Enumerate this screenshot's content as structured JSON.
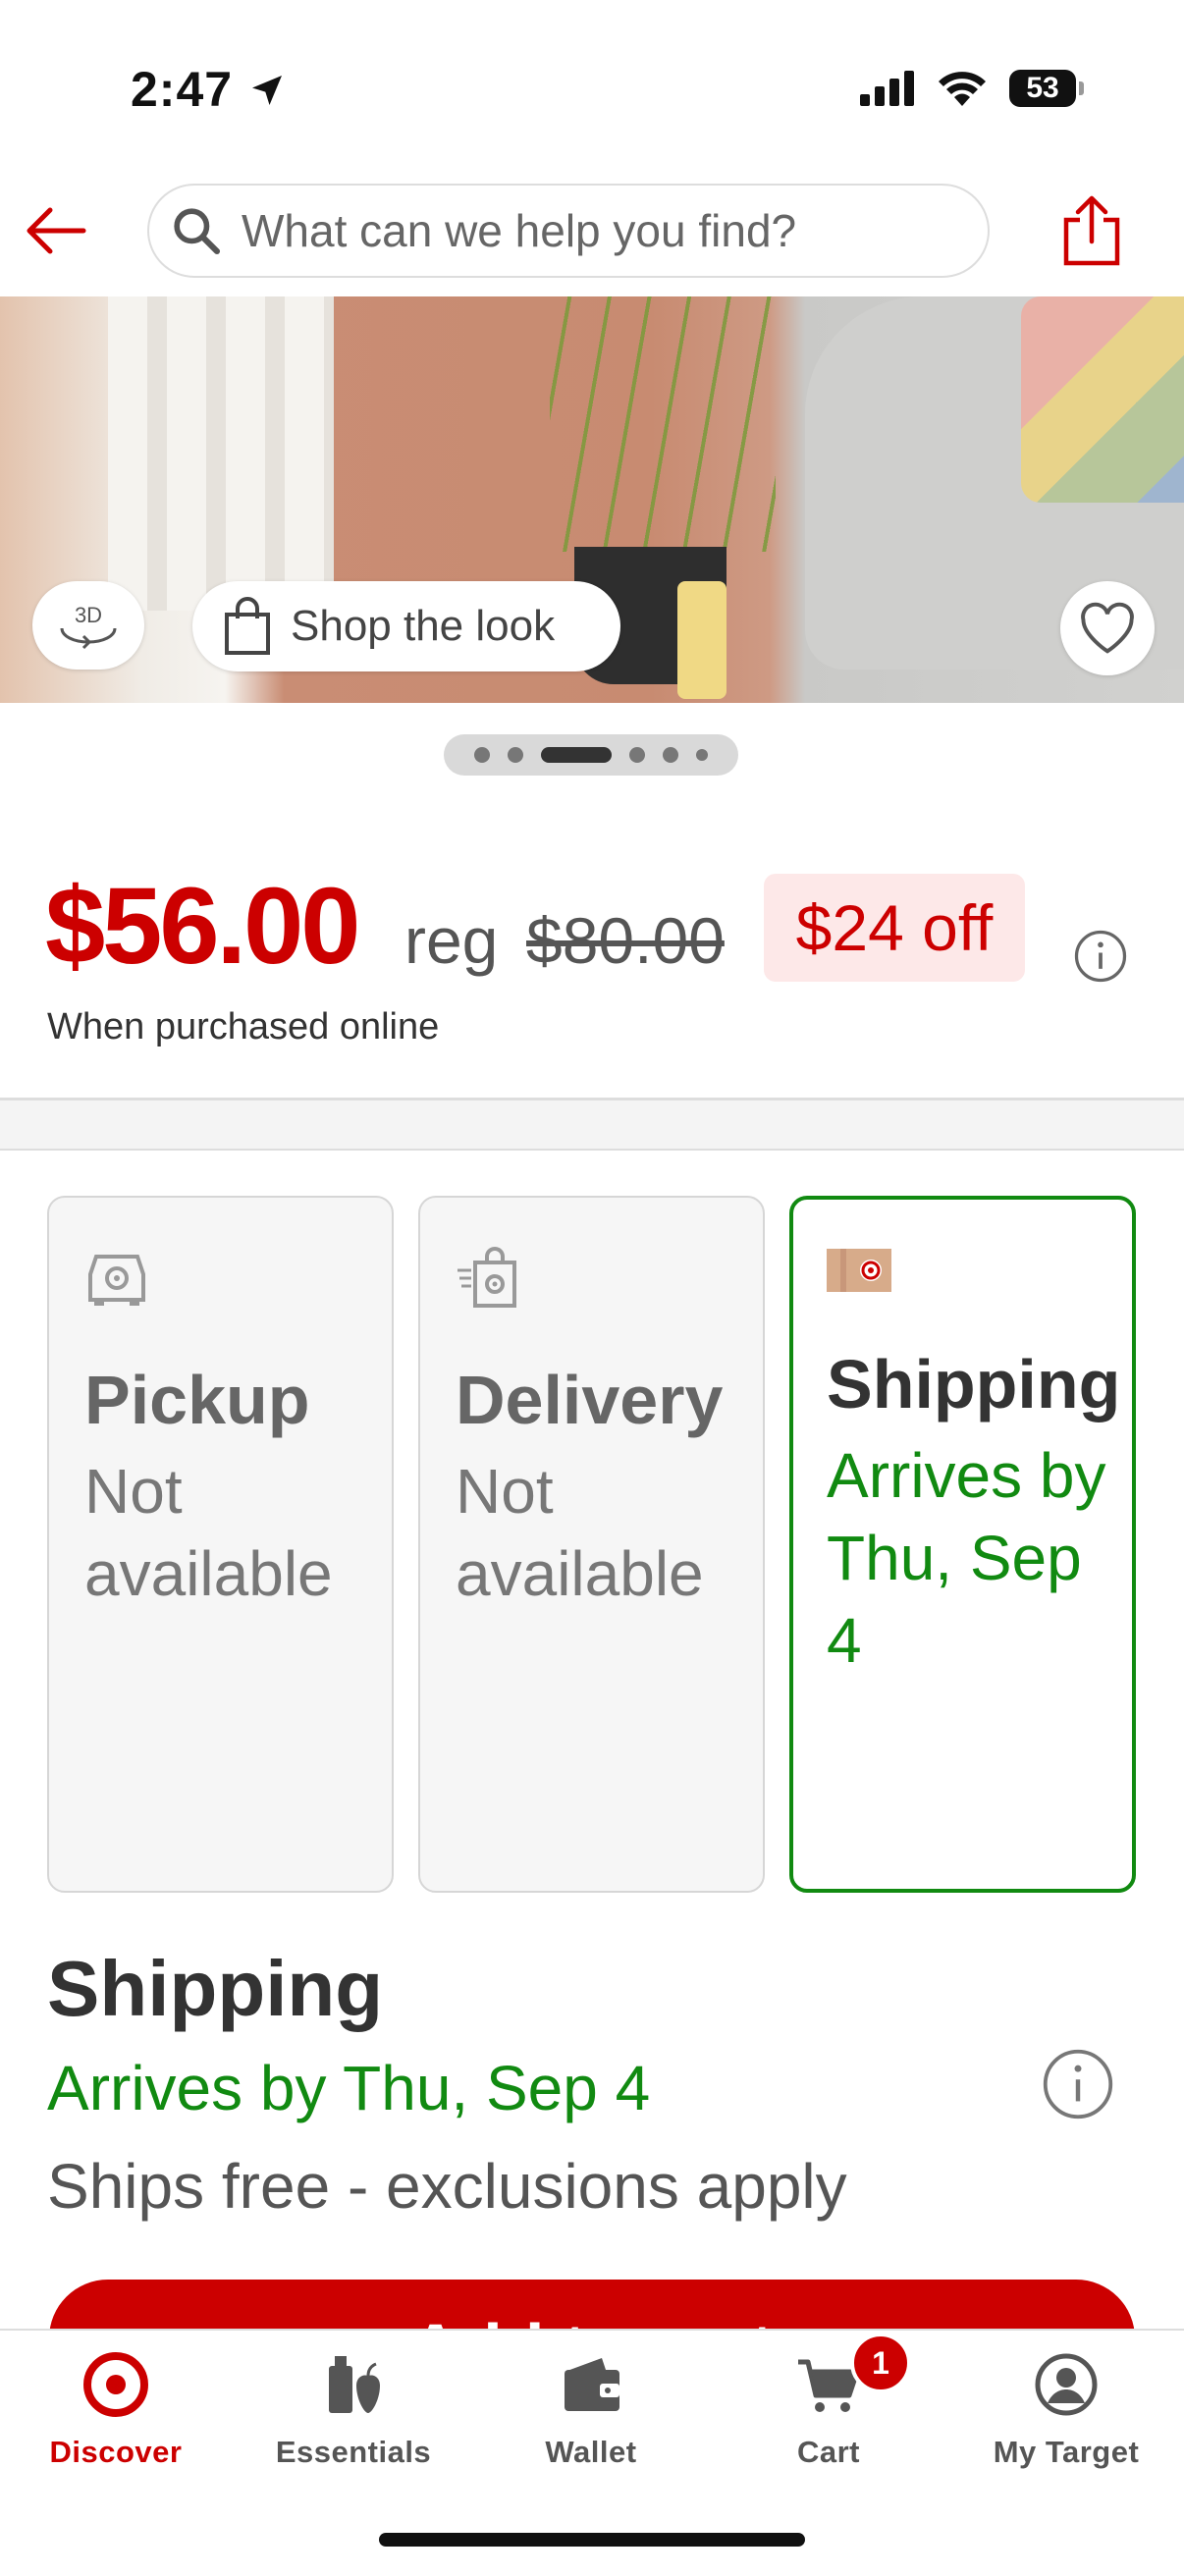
{
  "status_bar": {
    "time": "2:47",
    "battery": "53"
  },
  "header": {
    "search_placeholder": "What can we help you find?"
  },
  "hero": {
    "btn_3d": "3D",
    "shop_look": "Shop the look",
    "carousel_count": 7,
    "carousel_active": 3
  },
  "price": {
    "current": "$56.00",
    "reg_label": "reg",
    "reg_price": "$80.00",
    "discount": "$24 off",
    "note": "When purchased online"
  },
  "fulfillment": [
    {
      "title": "Pickup",
      "status": "Not available",
      "icon": "pickup-car-icon",
      "selected": false
    },
    {
      "title": "Delivery",
      "status": "Not available",
      "icon": "delivery-bag-icon",
      "selected": false
    },
    {
      "title": "Shipping",
      "status": "Arrives by Thu, Sep 4",
      "icon": "shipping-box-icon",
      "selected": true
    }
  ],
  "shipping": {
    "title": "Shipping",
    "arrives": "Arrives by Thu, Sep 4",
    "note": "Ships free - exclusions apply"
  },
  "add_button": "Add to cart",
  "tabs": [
    {
      "label": "Discover",
      "icon": "target-logo-icon",
      "active": true
    },
    {
      "label": "Essentials",
      "icon": "essentials-icon",
      "active": false
    },
    {
      "label": "Wallet",
      "icon": "wallet-icon",
      "active": false
    },
    {
      "label": "Cart",
      "icon": "cart-icon",
      "active": false
    },
    {
      "label": "My Target",
      "icon": "account-icon",
      "active": false
    }
  ],
  "cart_count": "1",
  "colors": {
    "brand_red": "#cc0000",
    "success_green": "#118a11"
  }
}
